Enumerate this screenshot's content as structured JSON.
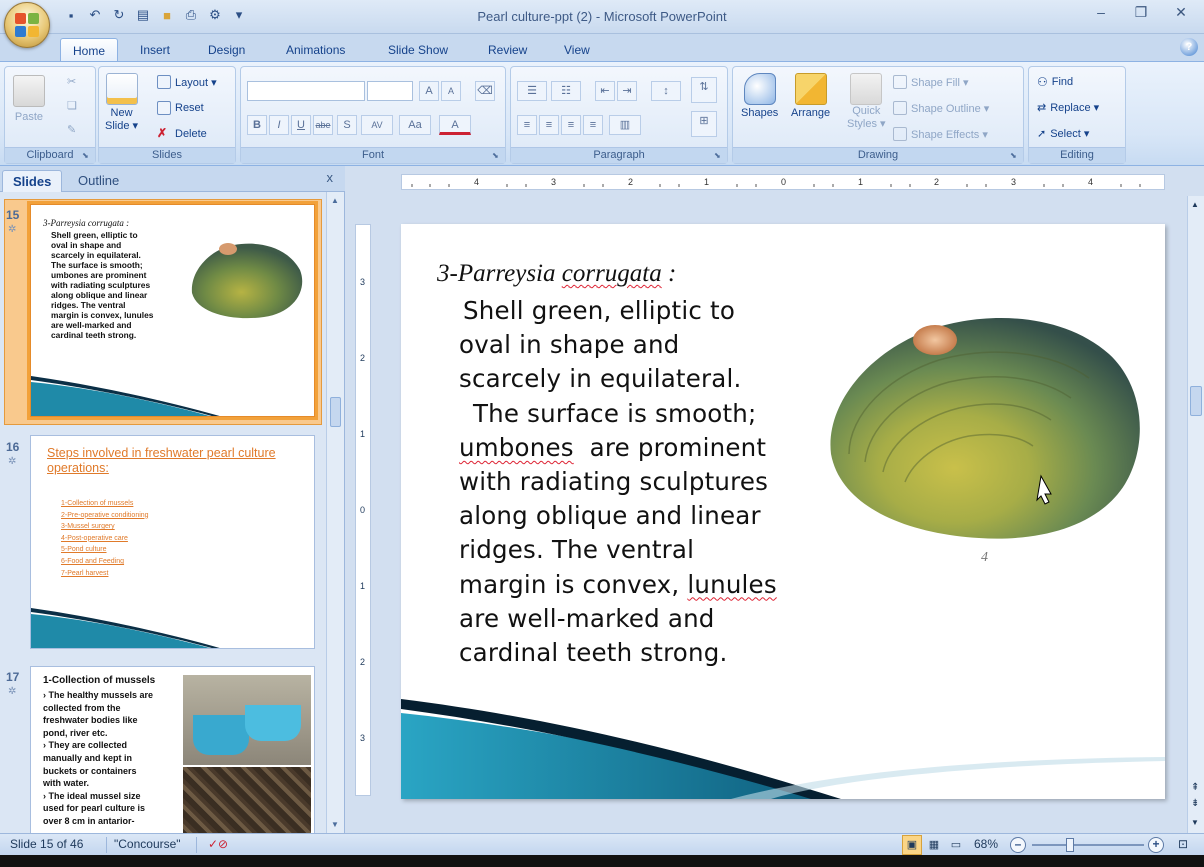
{
  "window": {
    "title": "Pearl culture-ppt (2) - Microsoft PowerPoint",
    "controls": [
      "minimize",
      "restore",
      "close"
    ]
  },
  "tabs": [
    {
      "label": "Home",
      "active": true
    },
    {
      "label": "Insert"
    },
    {
      "label": "Design"
    },
    {
      "label": "Animations"
    },
    {
      "label": "Slide Show"
    },
    {
      "label": "Review"
    },
    {
      "label": "View"
    }
  ],
  "ribbon": {
    "clipboard": {
      "paste": "Paste",
      "label": "Clipboard"
    },
    "slides": {
      "new_slide_1": "New",
      "new_slide_2": "Slide ▾",
      "layout": "Layout ▾",
      "reset": "Reset",
      "delete": "Delete",
      "label": "Slides"
    },
    "font": {
      "label": "Font",
      "grow": "A",
      "shrink": "A",
      "bold": "B",
      "italic": "I",
      "underline": "U",
      "strike": "abe",
      "shadow": "S",
      "spacing": "AV",
      "case": "Aa",
      "color": "A"
    },
    "paragraph": {
      "label": "Paragraph"
    },
    "drawing": {
      "shapes": "Shapes",
      "arrange": "Arrange",
      "quick_styles_1": "Quick",
      "quick_styles_2": "Styles ▾",
      "shape_fill": "Shape Fill ▾",
      "shape_outline": "Shape Outline ▾",
      "shape_effects": "Shape Effects ▾",
      "label": "Drawing"
    },
    "editing": {
      "find": "Find",
      "replace": "Replace ▾",
      "select": "Select ▾",
      "label": "Editing"
    }
  },
  "left_pane": {
    "tabs": [
      "Slides",
      "Outline"
    ],
    "close": "x",
    "thumbnails": [
      {
        "number": "15",
        "title": "3-Parreysia  corrugata :",
        "body": [
          "Shell green, elliptic to",
          "oval in shape and",
          "scarcely in equilateral.",
          " The surface is smooth;",
          "umbones  are prominent",
          "with radiating sculptures",
          "along oblique and linear",
          "ridges.  The ventral",
          "margin is convex, lunules",
          "are well-marked and",
          "cardinal teeth strong."
        ]
      },
      {
        "number": "16",
        "title": "Steps involved in freshwater pearl culture operations:",
        "items": [
          "1-Collection of mussels",
          "2-Pre-operative conditioning",
          "3-Mussel surgery",
          "4-Post-operative care",
          "5-Pond culture",
          "6-Food and Feeding",
          "7-Pearl harvest"
        ]
      },
      {
        "number": "17",
        "title": "1-Collection of mussels",
        "body": [
          "› The healthy mussels are",
          "  collected from the",
          "  freshwater bodies like",
          "  pond, river etc.",
          "› They are collected",
          "  manually and kept in",
          "  buckets or containers",
          "  with water.",
          "› The ideal mussel size",
          "  used for pearl culture is",
          "  over 8 cm in antarior-"
        ]
      }
    ]
  },
  "ruler": {
    "h_labels": [
      "4",
      "3",
      "2",
      "1",
      "0",
      "1",
      "2",
      "3",
      "4"
    ],
    "v_labels": [
      "3",
      "2",
      "1",
      "0",
      "1",
      "2",
      "3"
    ]
  },
  "slide": {
    "title_prefix": "3-Parreysia ",
    "title_species": "corrugata",
    "title_suffix": " :",
    "line1": "Shell green, elliptic to",
    "line2": "oval in shape and",
    "line3": "scarcely in equilateral.",
    "line4": "  The surface is smooth;",
    "line5_a": "umbones",
    "line5_b": "  are prominent",
    "line6": "with radiating sculptures",
    "line7": "along oblique and linear",
    "line8": "ridges.  The ventral",
    "line9_a": "margin is convex, ",
    "line9_b": "lunules",
    "line10": "are well-marked and",
    "line11": "cardinal teeth strong.",
    "image_caption": "4"
  },
  "status": {
    "slide_pos": "Slide 15 of 46",
    "theme": "\"Concourse\"",
    "zoom": "68%",
    "zoom_out": "–",
    "zoom_in": "+"
  },
  "colors": {
    "accent_orange": "#e07a2a",
    "ribbon_blue": "#15428b",
    "wave_teal": "#1f8aa8"
  }
}
